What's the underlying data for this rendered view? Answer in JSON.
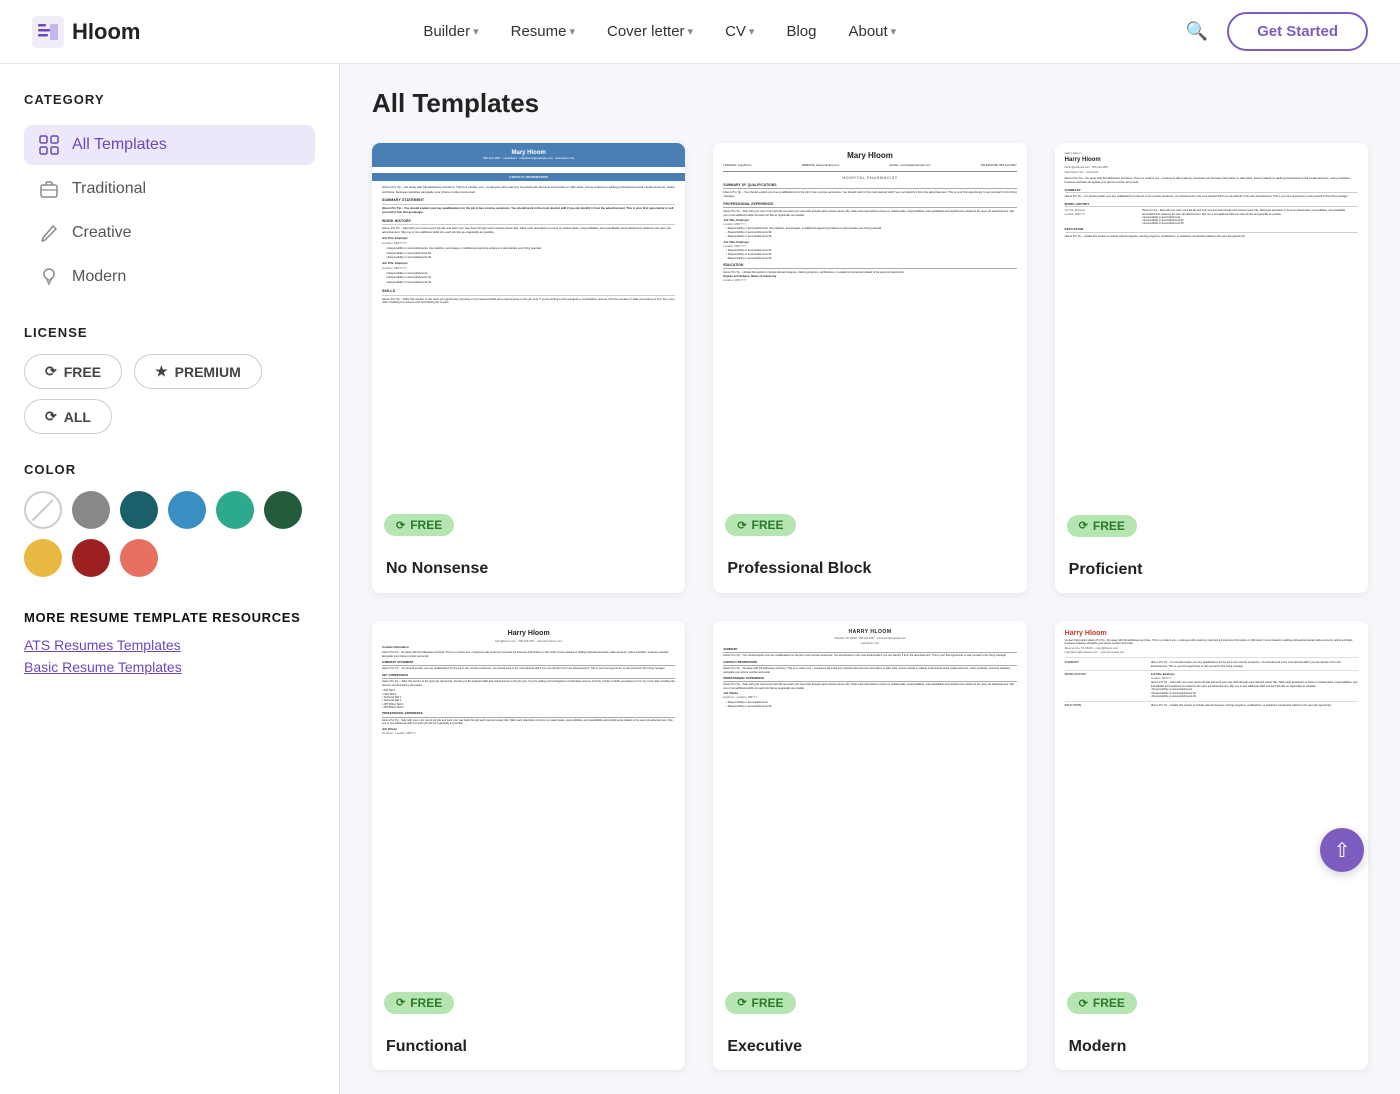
{
  "nav": {
    "logo_text": "Hloom",
    "links": [
      {
        "label": "Builder",
        "has_dropdown": true
      },
      {
        "label": "Resume",
        "has_dropdown": true
      },
      {
        "label": "Cover letter",
        "has_dropdown": true
      },
      {
        "label": "CV",
        "has_dropdown": true
      },
      {
        "label": "Blog",
        "has_dropdown": false
      },
      {
        "label": "About",
        "has_dropdown": true
      }
    ],
    "cta_label": "Get Started"
  },
  "sidebar": {
    "category_section_title": "CATEGORY",
    "categories": [
      {
        "id": "all",
        "label": "All Templates",
        "active": true
      },
      {
        "id": "traditional",
        "label": "Traditional",
        "active": false
      },
      {
        "id": "creative",
        "label": "Creative",
        "active": false
      },
      {
        "id": "modern",
        "label": "Modern",
        "active": false
      }
    ],
    "license_section_title": "LICENSE",
    "license_options": [
      {
        "id": "free",
        "label": "FREE"
      },
      {
        "id": "premium",
        "label": "PREMIUM"
      },
      {
        "id": "all",
        "label": "ALL"
      }
    ],
    "color_section_title": "COLOR",
    "colors": [
      {
        "id": "none",
        "hex": null,
        "label": "None"
      },
      {
        "id": "gray",
        "hex": "#888888"
      },
      {
        "id": "teal-dark",
        "hex": "#1a5f6a"
      },
      {
        "id": "blue",
        "hex": "#3a8fc2"
      },
      {
        "id": "green",
        "hex": "#2daa8e"
      },
      {
        "id": "dark-green",
        "hex": "#245c3b"
      },
      {
        "id": "yellow",
        "hex": "#e8b840"
      },
      {
        "id": "red",
        "hex": "#9c2020"
      },
      {
        "id": "coral",
        "hex": "#e87060"
      }
    ],
    "resources_title": "MORE RESUME TEMPLATE RESOURCES",
    "resource_links": [
      {
        "label": "ATS Resumes Templates"
      },
      {
        "label": "Basic Resume Templates"
      }
    ]
  },
  "main": {
    "title": "All Templates",
    "templates": [
      {
        "id": "no-nonsense",
        "name": "No Nonsense",
        "license": "FREE",
        "style": "blue-header"
      },
      {
        "id": "professional-block",
        "name": "Professional Block",
        "license": "FREE",
        "style": "centered"
      },
      {
        "id": "proficient",
        "name": "Proficient",
        "license": "FREE",
        "style": "sidebar-right"
      },
      {
        "id": "functional-1",
        "name": "Functional",
        "license": "FREE",
        "style": "functional"
      },
      {
        "id": "executive-1",
        "name": "Executive",
        "license": "FREE",
        "style": "executive"
      },
      {
        "id": "modern-1",
        "name": "Modern",
        "license": "FREE",
        "style": "modern"
      }
    ]
  }
}
